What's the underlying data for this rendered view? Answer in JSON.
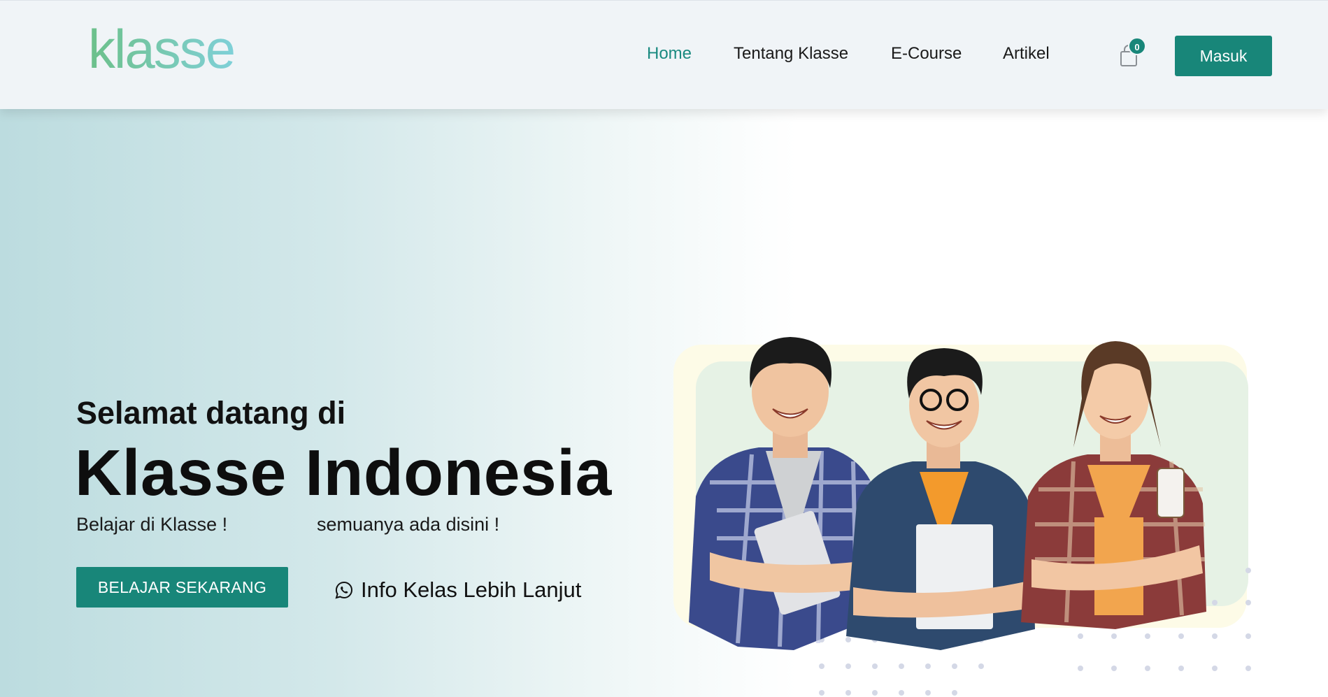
{
  "header": {
    "logo_text": "klasse",
    "nav": [
      {
        "label": "Home",
        "active": true
      },
      {
        "label": "Tentang Klasse",
        "active": false
      },
      {
        "label": "E-Course",
        "active": false
      },
      {
        "label": "Artikel",
        "active": false
      }
    ],
    "cart_count": "0",
    "cart_icon": "shopping-bag-icon",
    "login_label": "Masuk"
  },
  "hero": {
    "greeting": "Selamat datang di",
    "headline": "Klasse Indonesia",
    "tagline_left": "Belajar di Klasse !",
    "tagline_right": "semuanya ada disini !",
    "cta_label": "BELAJAR SEKARANG",
    "info_label": "Info Kelas Lebih Lanjut",
    "info_icon": "whatsapp-icon"
  },
  "colors": {
    "brand": "#188679",
    "active_nav": "#1a8a80",
    "logo_gradient_start": "#6cc08a",
    "logo_gradient_end": "#7fd0d8",
    "hero_gradient": "#bcdcdf"
  }
}
